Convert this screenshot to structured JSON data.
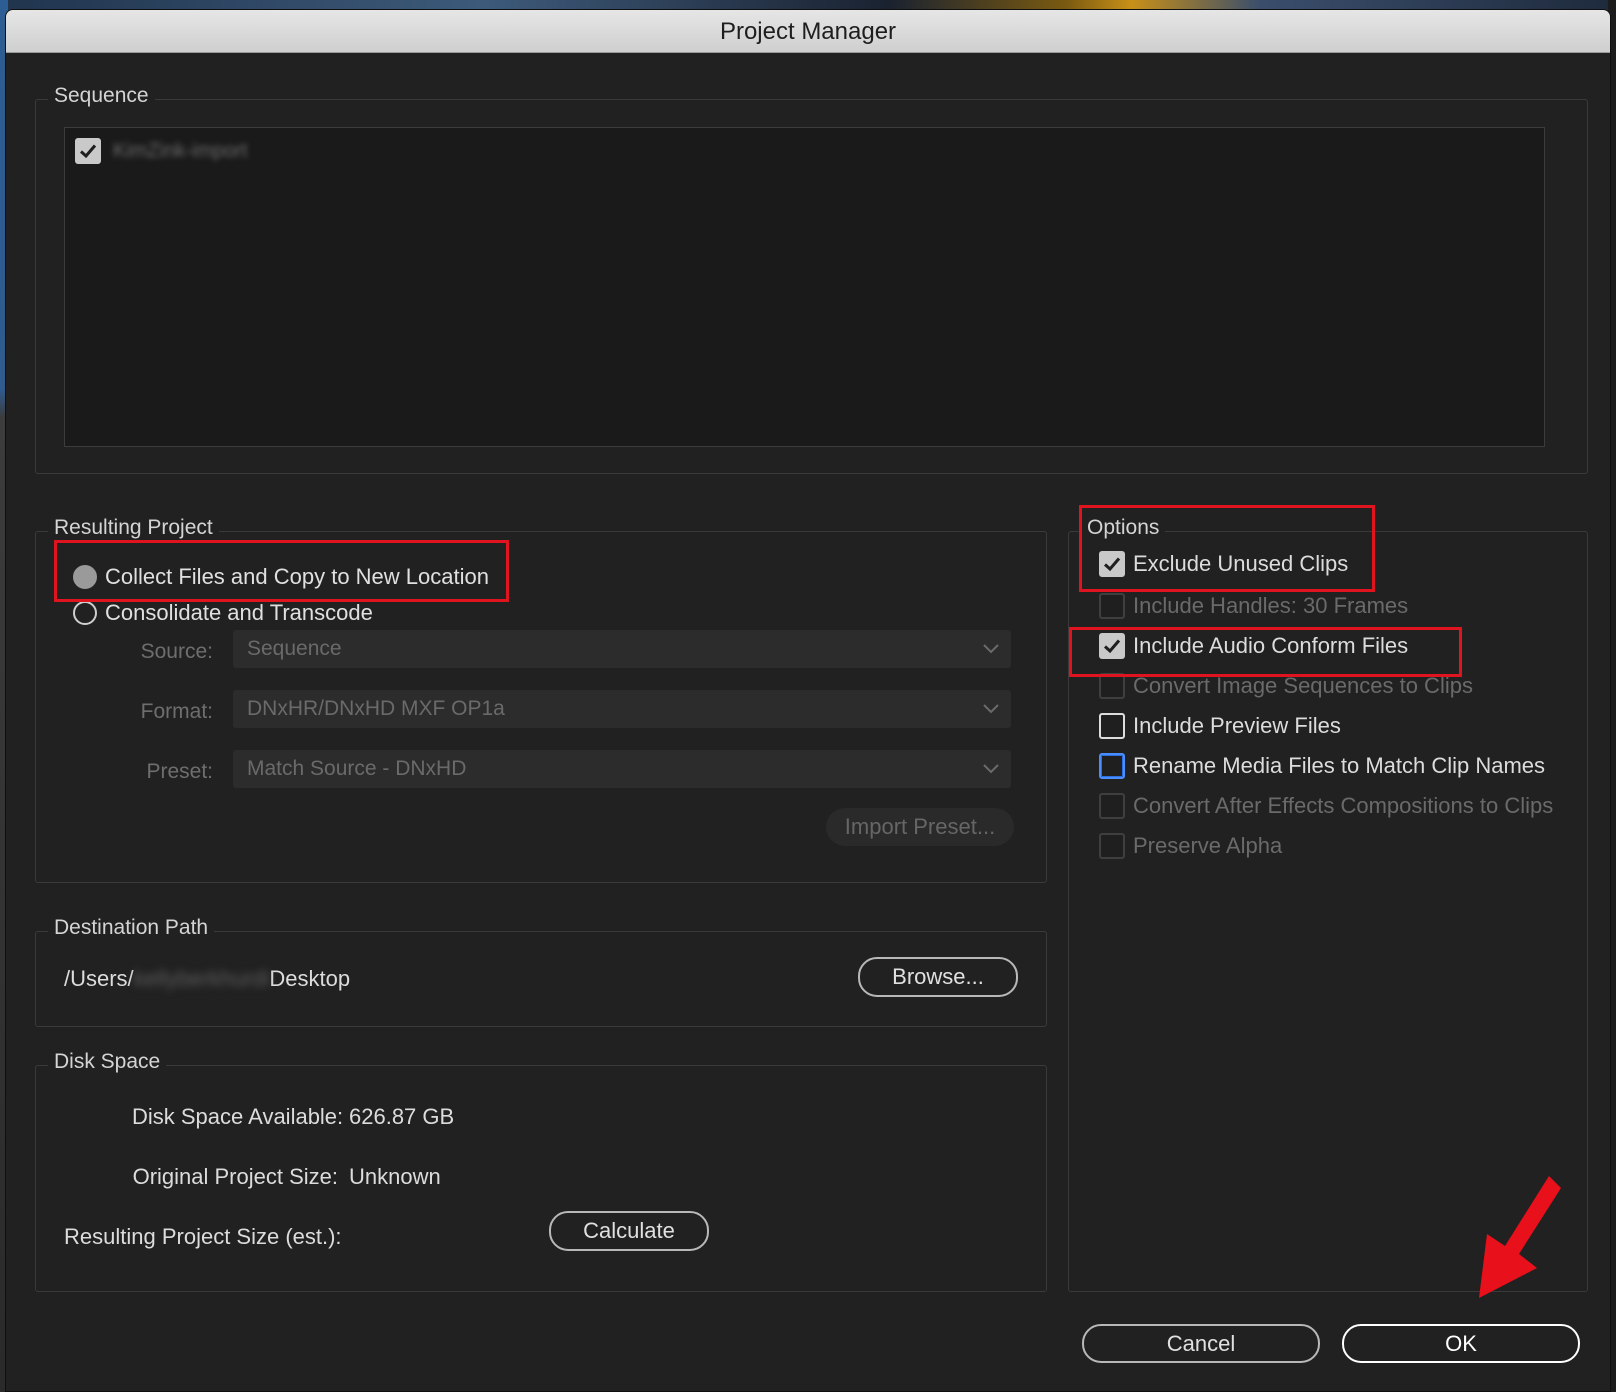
{
  "window": {
    "title": "Project Manager"
  },
  "sequence": {
    "legend": "Sequence",
    "items": [
      {
        "label": "KimZink-import",
        "checked": true,
        "blurred": true
      }
    ]
  },
  "resulting_project": {
    "legend": "Resulting Project",
    "radio_collect": "Collect Files and Copy to New Location",
    "radio_consolidate": "Consolidate and Transcode",
    "selected": "collect",
    "source_label": "Source:",
    "source_value": "Sequence",
    "format_label": "Format:",
    "format_value": "DNxHR/DNxHD MXF OP1a",
    "preset_label": "Preset:",
    "preset_value": "Match Source - DNxHD",
    "import_preset_label": "Import Preset..."
  },
  "options": {
    "legend": "Options",
    "items": [
      {
        "label": "Exclude Unused Clips",
        "checked": true,
        "enabled": true
      },
      {
        "label": "Include Handles:  30 Frames",
        "checked": false,
        "enabled": false
      },
      {
        "label": "Include Audio Conform Files",
        "checked": true,
        "enabled": true
      },
      {
        "label": "Convert Image Sequences to Clips",
        "checked": false,
        "enabled": false
      },
      {
        "label": "Include Preview Files",
        "checked": false,
        "enabled": true
      },
      {
        "label": "Rename Media Files to Match Clip Names",
        "checked": false,
        "enabled": true,
        "focused": true
      },
      {
        "label": "Convert After Effects Compositions to Clips",
        "checked": false,
        "enabled": false
      },
      {
        "label": "Preserve Alpha",
        "checked": false,
        "enabled": false
      }
    ]
  },
  "destination": {
    "legend": "Destination Path",
    "path_prefix": "/Users/",
    "path_hidden": "kellyberkhurdi",
    "path_suffix": "Desktop",
    "browse_label": "Browse..."
  },
  "disk_space": {
    "legend": "Disk Space",
    "available_label": "Disk Space Available:",
    "available_value": "626.87 GB",
    "original_label": "Original Project Size:",
    "original_value": "Unknown",
    "resulting_label": "Resulting Project Size (est.):",
    "calculate_label": "Calculate"
  },
  "footer": {
    "cancel_label": "Cancel",
    "ok_label": "OK"
  },
  "annotation_color": "#e0141e"
}
